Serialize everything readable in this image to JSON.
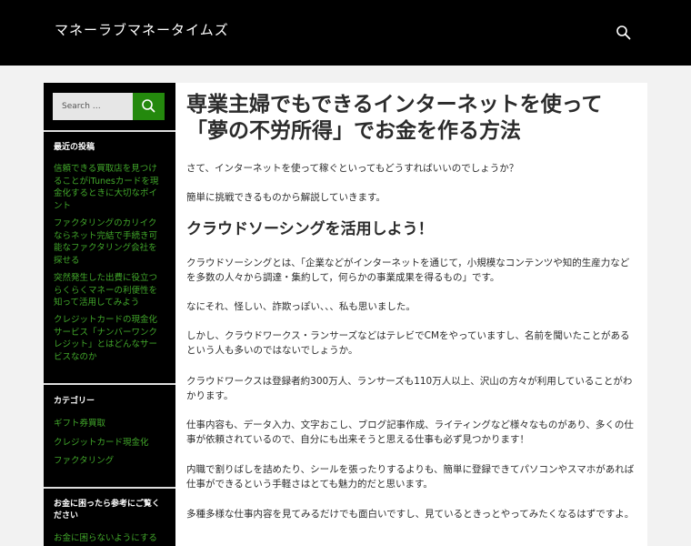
{
  "header": {
    "site_title": "マネーラブマネータイムズ",
    "search_icon": "search-icon"
  },
  "sidebar": {
    "search": {
      "placeholder": "Search …",
      "submit_icon": "search-icon"
    },
    "recent_posts": {
      "title": "最近の投稿",
      "items": [
        "信頼できる買取店を見つけることがiTunesカードを現金化するときに大切なポイント",
        "ファクタリングのカリイクならネット完結で手続き可能なファクタリング会社を探せる",
        "突然発生した出費に役立つらくらくマネーの利便性を知って活用してみよう",
        "クレジットカードの現金化サービス「ナンバーワンクレジット」とはどんなサービスなのか"
      ]
    },
    "categories": {
      "title": "カテゴリー",
      "items": [
        "ギフト券買取",
        "クレジットカード現金化",
        "ファクタリング"
      ]
    },
    "money_widget": {
      "title": "お金に困ったら参考にご覧ください",
      "items": [
        "お金に困らないようにする"
      ]
    },
    "accent_color": "#24890d",
    "link_color": "#41a62a"
  },
  "article": {
    "title": "専業主婦でもできるインターネットを使って「夢の不労所得」でお金を作る方法",
    "intro": "さて、インターネットを使って稼ぐといってもどうすればいいのでしょうか？",
    "intro2": "簡単に挑戦できるものから解説していきます。",
    "section_heading": "クラウドソーシングを活用しよう！",
    "paragraphs": [
      "クラウドソーシングとは、「企業などがインターネットを通じて，小規模なコンテンツや知的生産力などを多数の人々から調達・集約して，何らかの事業成果を得るもの」です。",
      "なにそれ、怪しい、詐欺っぽい、、、私も思いました。",
      "しかし、クラウドワークス・ランサーズなどはテレビでCMをやっていますし、名前を聞いたことがあるという人も多いのではないでしょうか。",
      "クラウドワークスは登録者約300万人、ランサーズも110万人以上、沢山の方々が利用していることがわかります。",
      "仕事内容も、データ入力、文字おこし、ブログ記事作成、ライティングなど様々なものがあり、多くの仕事が依頼されているので、自分にも出来そうと思える仕事も必ず見つかります！",
      "内職で割りばしを詰めたり、シールを張ったりするよりも、簡単に登録できてパソコンやスマホがあれば仕事ができるという手軽さはとても魅力的だと思います。",
      "多種多様な仕事内容を見てみるだけでも面白いですし、見ているときっとやってみたくなるはずですよ。"
    ]
  }
}
